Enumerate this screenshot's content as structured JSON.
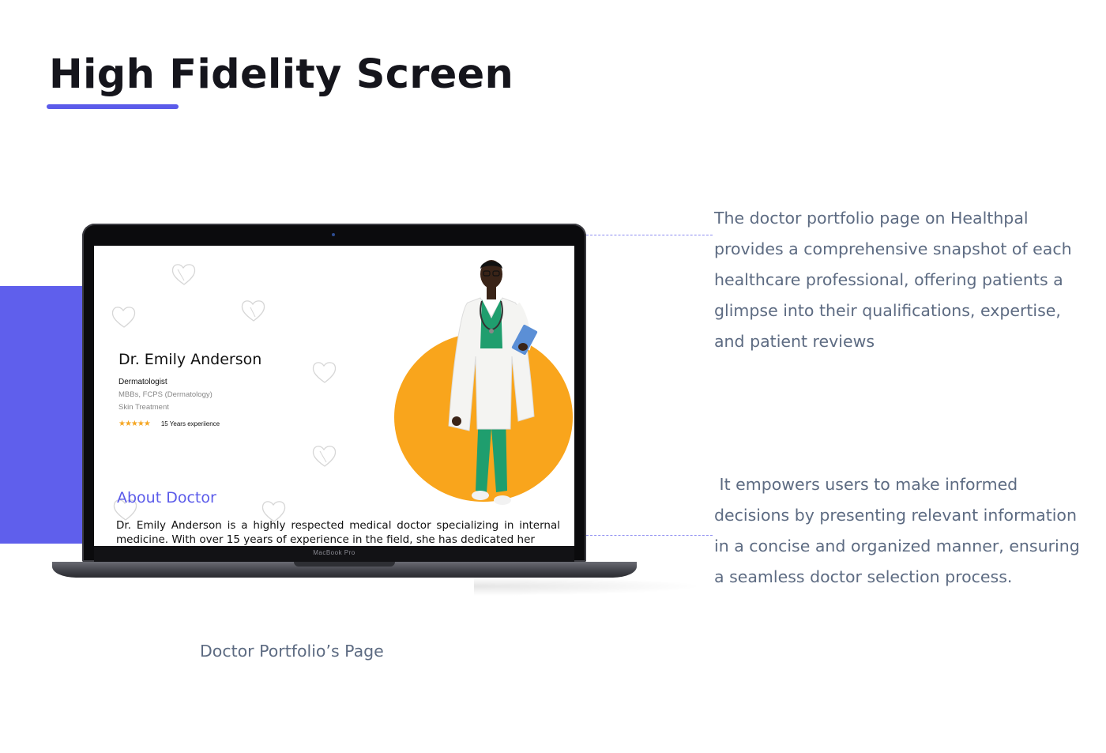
{
  "page": {
    "title": "High Fidelity Screen",
    "caption": "Doctor Portfolio’s  Page"
  },
  "descriptions": [
    "The doctor portfolio page on Healthpal provides a comprehensive snapshot of each healthcare professional, offering patients a glimpse into their qualifications, expertise, and patient reviews",
    " It empowers users to make informed decisions by presenting relevant information in a concise and organized manner, ensuring a seamless doctor selection process."
  ],
  "laptop": {
    "model_label": "MacBook Pro"
  },
  "doctor": {
    "name": "Dr. Emily Anderson",
    "specialty": "Dermatologist",
    "qualifications": "MBBs, FCPS (Dermatology)",
    "service": "Skin Treatment",
    "rating_stars": "★★★★★",
    "experience": "15 Years experiience",
    "about_title": "About Doctor",
    "about_text": "Dr. Emily Anderson is a highly respected medical doctor specializing in internal medicine. With over 15 years of experience in the field, she has dedicated her"
  },
  "colors": {
    "accent": "#5b5bea",
    "orange": "#f9a51c",
    "text_muted": "#5d6b82",
    "star": "#f5a623"
  },
  "icons": [
    "heart-outline-icon",
    "star-icon"
  ]
}
